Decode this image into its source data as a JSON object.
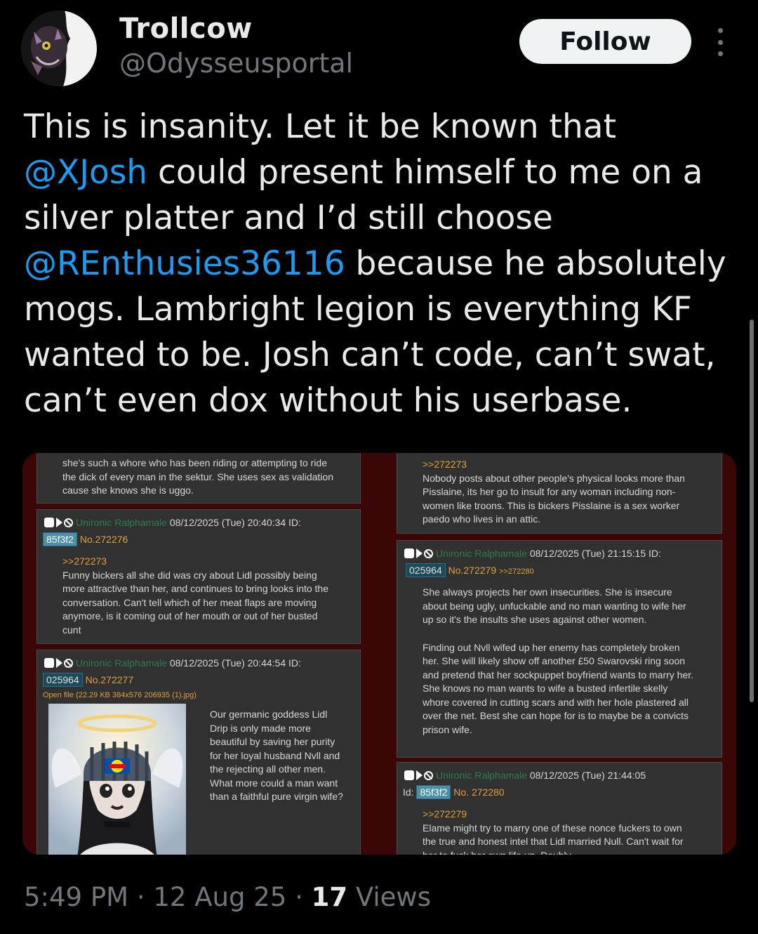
{
  "author": {
    "name": "Trollcow",
    "handle": "@Odysseusportal",
    "follow_label": "Follow"
  },
  "tweet": {
    "segments": [
      {
        "text": "This is insanity. Let it be known that ",
        "mention": false
      },
      {
        "text": "@XJosh",
        "mention": true
      },
      {
        "text": " could present himself to me on a silver platter and I’d still choose ",
        "mention": false
      },
      {
        "text": "@REnthusies36116",
        "mention": true
      },
      {
        "text": " because he absolutely mogs. Lambright legion is everything KF wanted to be. Josh can’t code, can’t swat, can’t even dox without his userbase.",
        "mention": false
      }
    ]
  },
  "media": {
    "left": {
      "top_post_text": "she's such a whore who has been riding or attempting to ride the dick of every man in the sektur. She uses sex as validation cause she knows she is uggo.",
      "post1": {
        "name": "Unironic Ralphamale",
        "date": "08/12/2025 (Tue) 20:40:34 ID:",
        "id": "85f3f2",
        "num": "No.272276",
        "quote": ">>272273",
        "text": "Funny bickers all she did was cry about Lidl possibly being more attractive than her, and continues to bring looks into the conversation. Can't tell which of her meat flaps are moving anymore, is it coming out of her mouth or out of her busted cunt"
      },
      "post2": {
        "name": "Unironic Ralphamale",
        "date": "08/12/2025 (Tue) 20:44:54 ID:",
        "id": "025964",
        "num": "No.272277",
        "file_prefix": "Open file (22.29 KB 384x576 ",
        "file_name": "206935 (1).jpg",
        "file_suffix": ")",
        "text": "Our germanic goddess Lidl Drip is only made more beautiful by saving her purity for her loyal husband Nvll and the rejecting all other men. What more could a man want than a faithful pure virgin wife?"
      }
    },
    "right": {
      "top_post": {
        "quote": ">>272273",
        "text": "Nobody posts about other people's physical looks more than Pisslaine, its her go to insult for any woman including non-women like troons. This is bickers Pisslaine is a sex worker paedo who lives in an attic."
      },
      "post1": {
        "name": "Unironic Ralphamale",
        "date": "08/12/2025 (Tue) 21:15:15 ID:",
        "id": "025964",
        "num": "No.272279",
        "backlink": ">>272280",
        "text1": "She always projects her own insecurities. She is insecure about being ugly, unfuckable and no man wanting to wife her up so it's the insults she uses against other women.",
        "text2": "Finding out Nvll wifed up her enemy has completely broken her. She will likely show off another £50 Swarovski ring soon and pretend that her sockpuppet boyfriend wants to marry her. She knows no man wants to wife a busted infertile skelly whore covered in cutting scars and with her hole plastered all over the net. Best she can hope for is to maybe be a convicts prison wife."
      },
      "post2": {
        "name": "Unironic Ralphamale",
        "date": "08/12/2025 (Tue) 21:44:05",
        "id_label": "Id:",
        "id": "85f3f2",
        "num": "No. 272280",
        "quote": ">>272279",
        "text": "Elame might try to marry one of these nonce fuckers to own the true and honest intel that Lidl married Null. Can't wait for her to fuck her own life up. Doubly"
      }
    }
  },
  "footer": {
    "time": "5:49 PM",
    "sep1": " · ",
    "date": "12 Aug 25",
    "sep2": " · ",
    "views_count": "17",
    "views_label": " Views"
  },
  "colors": {
    "background": "#000000",
    "mention": "#1d9bf0",
    "muted": "#71767b",
    "follow_bg": "#eff3f4",
    "post_bg": "#313131",
    "frame_red": "#5a0a0a"
  }
}
